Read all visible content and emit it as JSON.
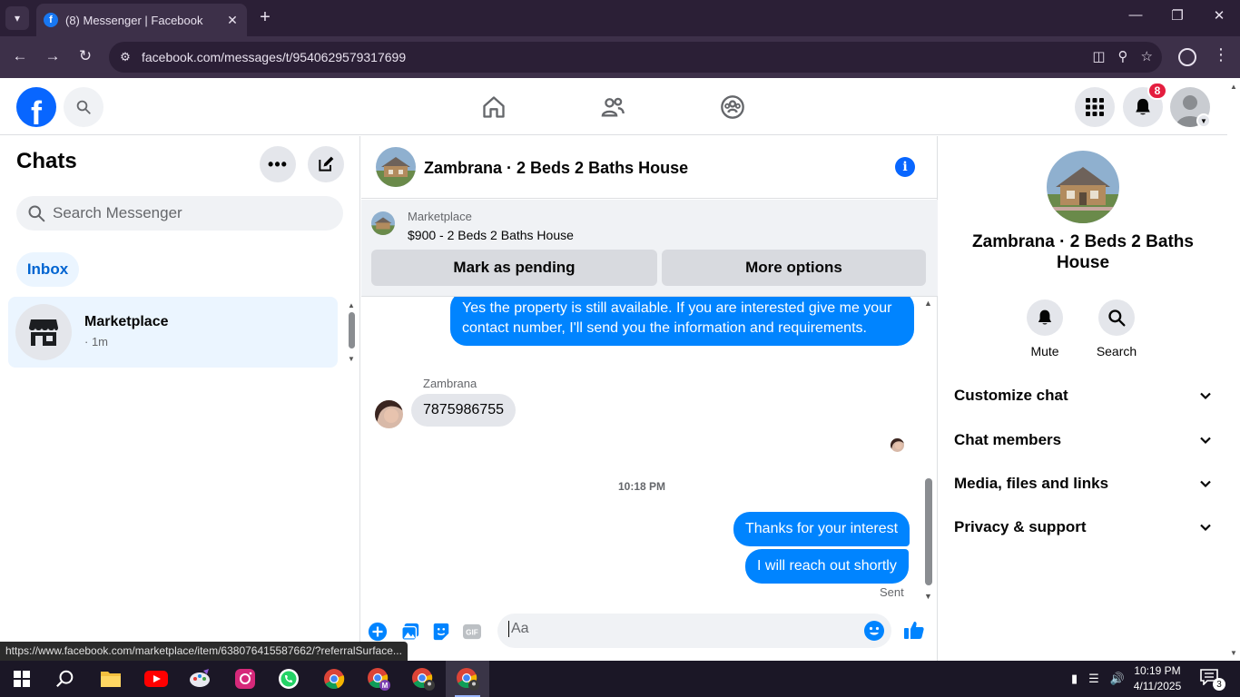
{
  "browser": {
    "tab_title": "(8) Messenger | Facebook",
    "url": "facebook.com/messages/t/9540629579317699",
    "status_link": "https://www.facebook.com/marketplace/item/638076415587662/?referralSurface..."
  },
  "fb": {
    "logo_letter": "f",
    "notification_count": "8",
    "icons": [
      "search-icon",
      "home-icon",
      "friends-icon",
      "groups-icon",
      "menu-grid-icon",
      "bell-icon",
      "profile-avatar"
    ]
  },
  "chats": {
    "title": "Chats",
    "search_placeholder": "Search Messenger",
    "inbox_label": "Inbox",
    "items": [
      {
        "name": "Marketplace",
        "meta": "· 1m",
        "icon": "store-icon"
      }
    ]
  },
  "conversation": {
    "title": "Zambrana · 2 Beds 2 Baths House",
    "marketplace": {
      "label": "Marketplace",
      "listing": "$900 - 2 Beds 2 Baths House",
      "pending_button": "Mark as pending",
      "options_button": "More options"
    },
    "messages": {
      "first_out": "Yes the property is still available. If you are interested  give me your contact number, I'll send you the information and requirements.",
      "sender": "Zambrana",
      "incoming": "7875986755",
      "timestamp": "10:18 PM",
      "out_1": "Thanks for your interest",
      "out_2": "I will reach out shortly",
      "status": "Sent"
    },
    "composer_placeholder": "Aa",
    "colors": {
      "outgoing": "#0084ff",
      "incoming": "#e4e6eb"
    }
  },
  "info_panel": {
    "name": "Zambrana · 2 Beds 2 Baths House",
    "mute_label": "Mute",
    "search_label": "Search",
    "sections": [
      "Customize chat",
      "Chat members",
      "Media, files and links",
      "Privacy & support"
    ]
  },
  "taskbar": {
    "time": "10:19 PM",
    "date": "4/11/2025",
    "notification_count": "3"
  }
}
